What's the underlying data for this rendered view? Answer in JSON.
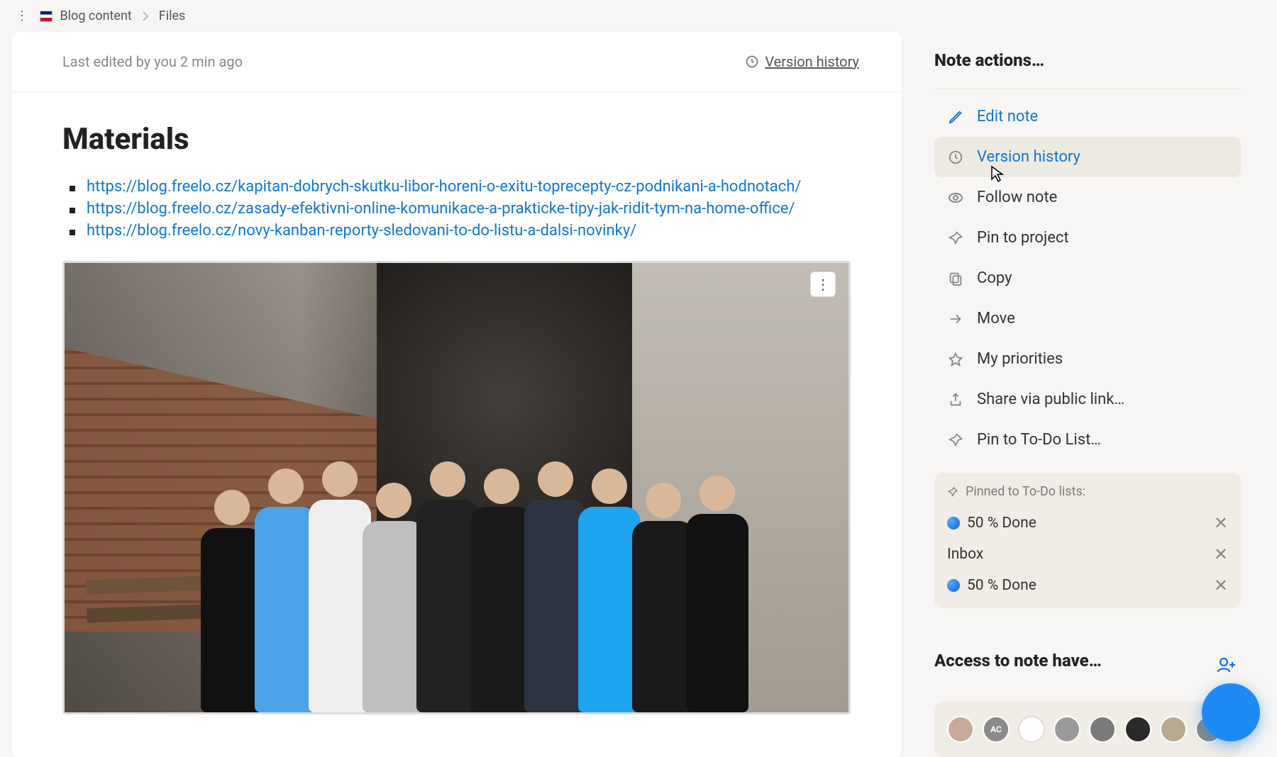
{
  "breadcrumb": {
    "project": "Blog content",
    "page": "Files"
  },
  "header": {
    "edited": "Last edited by you 2 min ago",
    "version_history": "Version history"
  },
  "content": {
    "title": "Materials",
    "links": [
      "https://blog.freelo.cz/kapitan-dobrych-skutku-libor-horeni-o-exitu-toprecepty-cz-podnikani-a-hodnotach/",
      "https://blog.freelo.cz/zasady-efektivni-online-komunikace-a-prakticke-tipy-jak-ridit-tym-na-home-office/",
      "https://blog.freelo.cz/novy-kanban-reporty-sledovani-to-do-listu-a-dalsi-novinky/"
    ]
  },
  "sidebar": {
    "actions_title": "Note actions…",
    "actions": {
      "edit": "Edit note",
      "version_history": "Version history",
      "follow": "Follow note",
      "pin_project": "Pin to project",
      "copy": "Copy",
      "move": "Move",
      "priorities": "My priorities",
      "share": "Share via public link…",
      "pin_todo": "Pin to To-Do List…"
    },
    "pinned": {
      "heading": "Pinned to To-Do lists:",
      "items": [
        {
          "dot": true,
          "label": "50 % Done"
        },
        {
          "dot": false,
          "label": "Inbox"
        },
        {
          "dot": true,
          "label": "50 % Done"
        }
      ]
    },
    "access_title": "Access to note have…",
    "avatars": [
      {
        "style": "bg:#caa;"
      },
      {
        "style": "bg:#8a8a8a;",
        "txt": "AC"
      },
      {
        "style": "bg:#fff;"
      },
      {
        "style": "bg:#999;"
      },
      {
        "style": "bg:#777;"
      },
      {
        "style": "bg:#222;"
      },
      {
        "style": "bg:#b9a;"
      },
      {
        "style": "bg:#888;"
      }
    ]
  }
}
